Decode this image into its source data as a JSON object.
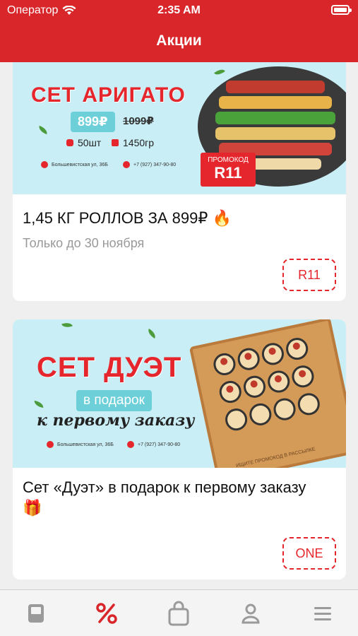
{
  "status_bar": {
    "carrier": "Оператор",
    "time": "2:35 AM"
  },
  "header": {
    "title": "Акции"
  },
  "colors": {
    "brand": "#d8262a",
    "accent": "#6dcfd8",
    "muted_text": "#999999"
  },
  "promos": [
    {
      "banner": {
        "set_name": "СЕТ АРИГАТО",
        "price": "899₽",
        "old_price": "1099₽",
        "pieces": "50шт",
        "weight": "1450гр",
        "address": "Большевистская ул, 36Б",
        "phone": "+7 (927) 347-90-80",
        "promo_label": "ПРОМОКОД",
        "promo_code": "R11"
      },
      "title": "1,45 КГ РОЛЛОВ ЗА 899₽ 🔥",
      "subtitle": "Только до 30 ноября",
      "code_button": "R11"
    },
    {
      "banner": {
        "set_name": "СЕТ ДУЭТ",
        "gift_chip": "в подарок",
        "script_line": "к первому заказу",
        "board_text": "ИЩИТЕ ПРОМОКОД В РАССЫЛКЕ",
        "address": "Большевистская ул, 36Б",
        "phone": "+7 (927) 347-90-80"
      },
      "title": "Сет «Дуэт» в подарок к первому заказу🎁",
      "code_button": "ONE"
    }
  ],
  "tabbar": {
    "items": [
      {
        "icon": "menu-book-icon",
        "active": false
      },
      {
        "icon": "percent-icon",
        "active": true
      },
      {
        "icon": "shopping-bag-icon",
        "active": false
      },
      {
        "icon": "profile-icon",
        "active": false
      },
      {
        "icon": "hamburger-icon",
        "active": false
      }
    ]
  }
}
